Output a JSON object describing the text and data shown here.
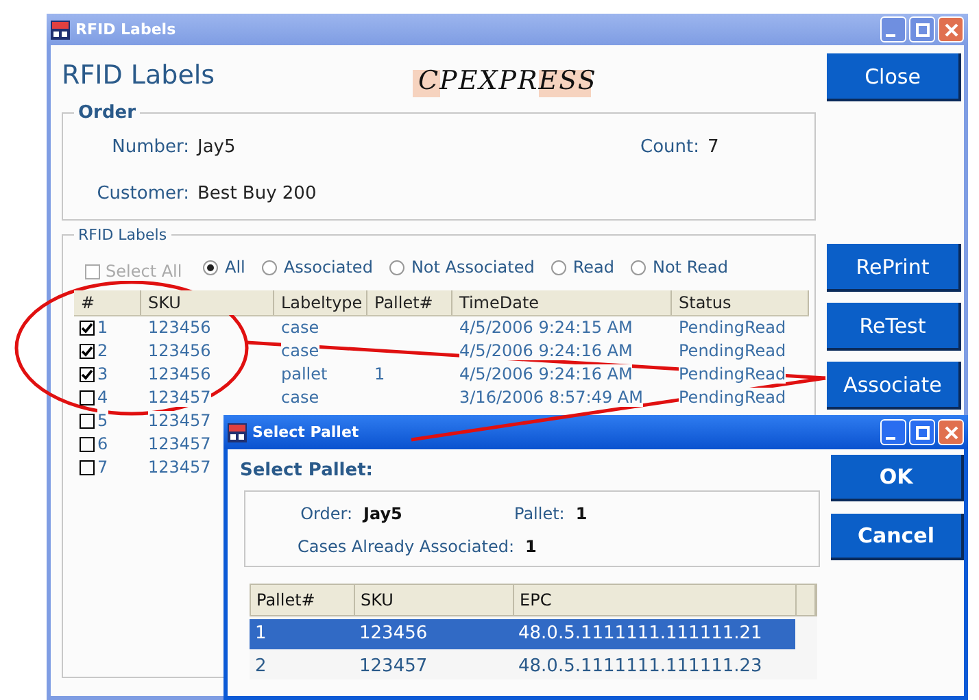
{
  "main_window": {
    "title": "RFID Labels",
    "heading": "RFID Labels",
    "logo": "CPEXPRESS",
    "order": {
      "title": "Order",
      "number_label": "Number:",
      "number": "Jay5",
      "count_label": "Count:",
      "count": "7",
      "customer_label": "Customer:",
      "customer": "Best Buy 200"
    },
    "labels": {
      "title": "RFID Labels",
      "select_all": {
        "label": "Select All",
        "checked": false,
        "disabled": true
      },
      "filters": [
        {
          "label": "All",
          "selected": true
        },
        {
          "label": "Associated",
          "selected": false
        },
        {
          "label": "Not Associated",
          "selected": false
        },
        {
          "label": "Read",
          "selected": false
        },
        {
          "label": "Not Read",
          "selected": false
        }
      ],
      "columns": [
        "#",
        "SKU",
        "Labeltype",
        "Pallet#",
        "TimeDate",
        "Status"
      ],
      "rows": [
        {
          "checked": true,
          "cells": [
            "1",
            "123456",
            "case",
            "",
            "4/5/2006 9:24:15 AM",
            "PendingRead"
          ]
        },
        {
          "checked": true,
          "cells": [
            "2",
            "123456",
            "case",
            "",
            "4/5/2006 9:24:16 AM",
            "PendingRead"
          ]
        },
        {
          "checked": true,
          "cells": [
            "3",
            "123456",
            "pallet",
            "1",
            "4/5/2006 9:24:16 AM",
            "PendingRead"
          ]
        },
        {
          "checked": false,
          "cells": [
            "4",
            "123457",
            "case",
            "",
            "3/16/2006 8:57:49 AM",
            "PendingRead"
          ]
        },
        {
          "checked": false,
          "cells": [
            "5",
            "123457"
          ]
        },
        {
          "checked": false,
          "cells": [
            "6",
            "123457"
          ]
        },
        {
          "checked": false,
          "cells": [
            "7",
            "123457"
          ]
        }
      ]
    },
    "buttons": [
      {
        "kind": "close",
        "label": "Close"
      },
      {
        "kind": "reprint",
        "label": "RePrint"
      },
      {
        "kind": "retest",
        "label": "ReTest"
      },
      {
        "kind": "associate",
        "label": "Associate"
      }
    ]
  },
  "dialog": {
    "title": "Select Pallet",
    "heading": "Select Pallet:",
    "order_label": "Order:",
    "order": "Jay5",
    "pallet_label": "Pallet:",
    "pallet": "1",
    "cases_label": "Cases Already Associated:",
    "cases": "1",
    "columns": [
      "Pallet#",
      "SKU",
      "EPC"
    ],
    "rows": [
      {
        "selected": true,
        "cells": [
          "1",
          "123456",
          "48.0.5.1111111.111111.21"
        ]
      },
      {
        "selected": false,
        "cells": [
          "2",
          "123457",
          "48.0.5.1111111.111111.23"
        ]
      }
    ],
    "buttons": [
      "OK",
      "Cancel"
    ]
  }
}
